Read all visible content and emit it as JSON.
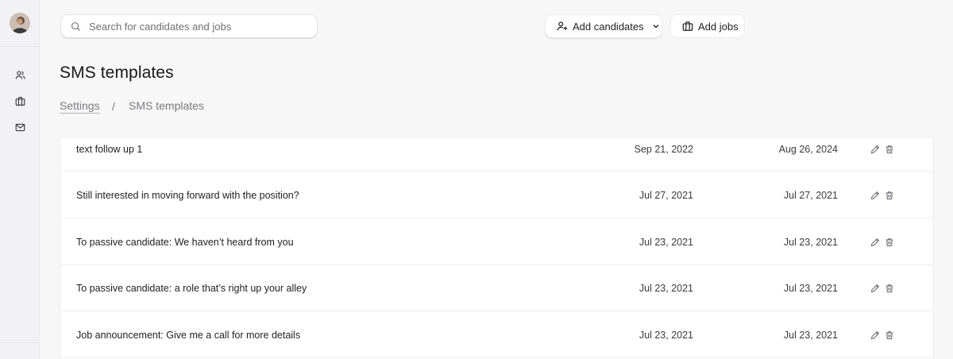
{
  "search": {
    "placeholder": "Search for candidates and jobs"
  },
  "header": {
    "add_candidates_label": "Add candidates",
    "add_jobs_label": "Add jobs"
  },
  "page": {
    "title": "SMS templates"
  },
  "breadcrumb": {
    "parent": "Settings",
    "separator": "/",
    "current": "SMS templates"
  },
  "sidebar": {
    "items": [
      {
        "icon": "users-icon"
      },
      {
        "icon": "briefcase-icon"
      },
      {
        "icon": "mail-icon"
      }
    ]
  },
  "templates": [
    {
      "name": "text follow up 1",
      "created": "Sep 21, 2022",
      "updated": "Aug 26, 2024"
    },
    {
      "name": "Still interested in moving forward with the position?",
      "created": "Jul 27, 2021",
      "updated": "Jul 27, 2021"
    },
    {
      "name": "To passive candidate: We haven’t heard from you",
      "created": "Jul 23, 2021",
      "updated": "Jul 23, 2021"
    },
    {
      "name": "To passive candidate: a role that’s right up your alley",
      "created": "Jul 23, 2021",
      "updated": "Jul 23, 2021"
    },
    {
      "name": "Job announcement: Give me a call for more details",
      "created": "Jul 23, 2021",
      "updated": "Jul 23, 2021"
    }
  ],
  "colors": {
    "background": "#f7f7f8",
    "sidebar": "#f2f1f6",
    "text": "#1f1f23",
    "muted": "#7a7a80"
  }
}
